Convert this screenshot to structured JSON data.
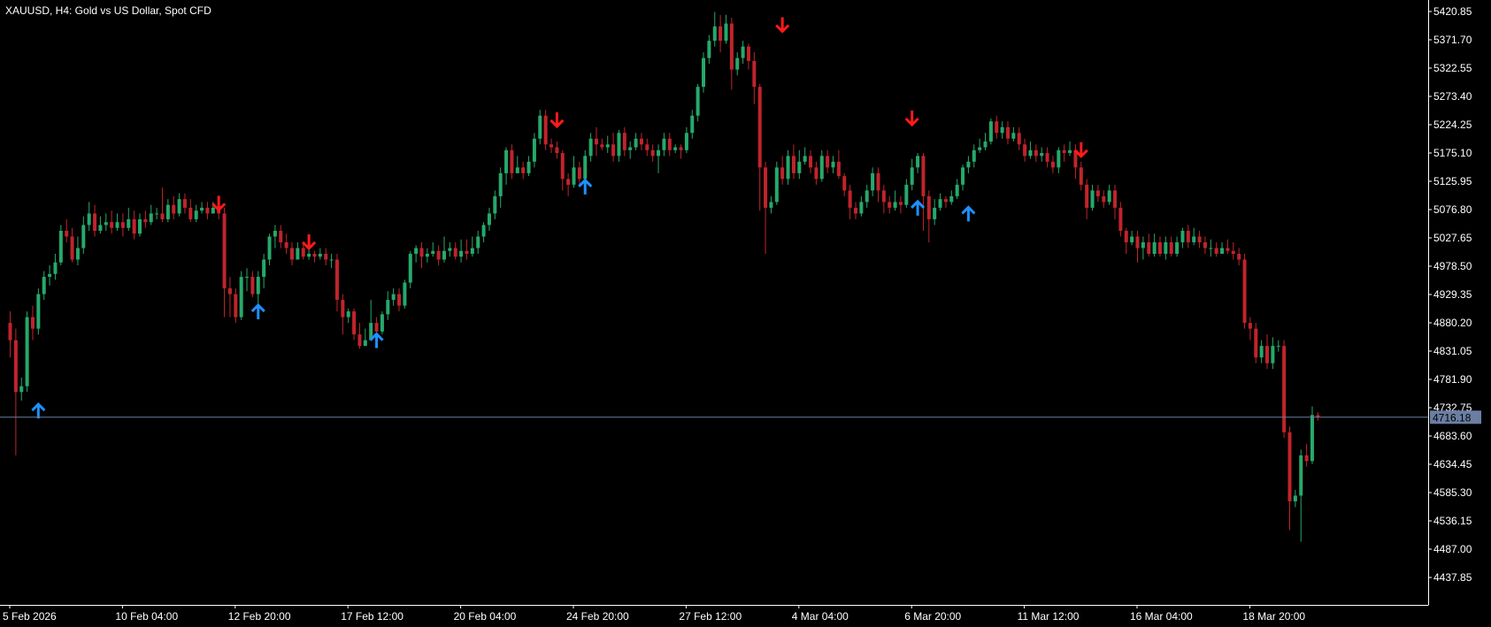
{
  "chart_data": {
    "type": "candlestick",
    "title": "XAUUSD, H4:  Gold vs US Dollar, Spot CFD",
    "ylim": [
      4400,
      5430
    ],
    "yticks": [
      "5420.85",
      "5371.70",
      "5322.55",
      "5273.40",
      "5224.25",
      "5175.10",
      "5125.95",
      "5076.80",
      "5027.65",
      "4978.50",
      "4929.35",
      "4880.20",
      "4831.05",
      "4781.90",
      "4732.75",
      "4683.60",
      "4634.45",
      "4585.30",
      "4536.15",
      "4487.00",
      "4437.85"
    ],
    "xticks": [
      {
        "label": "5 Feb 2026",
        "bar": 0
      },
      {
        "label": "10 Feb 04:00",
        "bar": 20
      },
      {
        "label": "12 Feb 20:00",
        "bar": 40
      },
      {
        "label": "17 Feb 12:00",
        "bar": 60
      },
      {
        "label": "20 Feb 04:00",
        "bar": 80
      },
      {
        "label": "24 Feb 20:00",
        "bar": 100
      },
      {
        "label": "27 Feb 12:00",
        "bar": 120
      },
      {
        "label": "4 Mar 04:00",
        "bar": 140
      },
      {
        "label": "6 Mar 20:00",
        "bar": 160
      },
      {
        "label": "11 Mar 12:00",
        "bar": 180
      },
      {
        "label": "16 Mar 04:00",
        "bar": 200
      },
      {
        "label": "18 Mar 20:00",
        "bar": 220
      }
    ],
    "current_price": "4716.18",
    "colors": {
      "up": "#26a96b",
      "down": "#c0242b",
      "up_arrow": "#1e90ff",
      "down_arrow": "#ff1a1a",
      "price_line": "#6b7fa3",
      "axis": "#ffffff",
      "background": "#000000"
    },
    "candles": [
      [
        4880,
        4850,
        4900,
        4820
      ],
      [
        4850,
        4760,
        4870,
        4650
      ],
      [
        4760,
        4770,
        4785,
        4745
      ],
      [
        4770,
        4890,
        4900,
        4760
      ],
      [
        4890,
        4870,
        4910,
        4850
      ],
      [
        4870,
        4930,
        4940,
        4860
      ],
      [
        4930,
        4960,
        4970,
        4920
      ],
      [
        4960,
        4965,
        4980,
        4945
      ],
      [
        4965,
        4985,
        5000,
        4955
      ],
      [
        4985,
        5040,
        5050,
        4980
      ],
      [
        5040,
        5030,
        5060,
        5020
      ],
      [
        5030,
        4990,
        5045,
        4985
      ],
      [
        4990,
        5010,
        5030,
        4980
      ],
      [
        5010,
        5050,
        5065,
        5000
      ],
      [
        5050,
        5070,
        5090,
        5040
      ],
      [
        5070,
        5040,
        5085,
        5030
      ],
      [
        5040,
        5050,
        5065,
        5035
      ],
      [
        5050,
        5055,
        5070,
        5040
      ],
      [
        5055,
        5045,
        5075,
        5035
      ],
      [
        5045,
        5055,
        5070,
        5040
      ],
      [
        5055,
        5045,
        5070,
        5030
      ],
      [
        5045,
        5060,
        5080,
        5040
      ],
      [
        5060,
        5035,
        5075,
        5025
      ],
      [
        5035,
        5060,
        5070,
        5030
      ],
      [
        5060,
        5055,
        5075,
        5045
      ],
      [
        5055,
        5070,
        5085,
        5050
      ],
      [
        5070,
        5070,
        5080,
        5060
      ],
      [
        5070,
        5060,
        5115,
        5055
      ],
      [
        5060,
        5085,
        5095,
        5055
      ],
      [
        5085,
        5070,
        5100,
        5060
      ],
      [
        5070,
        5095,
        5105,
        5065
      ],
      [
        5095,
        5080,
        5105,
        5070
      ],
      [
        5080,
        5060,
        5095,
        5055
      ],
      [
        5060,
        5075,
        5085,
        5055
      ],
      [
        5075,
        5080,
        5090,
        5070
      ],
      [
        5080,
        5070,
        5090,
        5060
      ],
      [
        5070,
        5080,
        5090,
        5070
      ],
      [
        5080,
        5070,
        5090,
        5060
      ],
      [
        5070,
        4940,
        5080,
        4890
      ],
      [
        4940,
        4930,
        4960,
        4890
      ],
      [
        4930,
        4890,
        4940,
        4880
      ],
      [
        4890,
        4960,
        4970,
        4885
      ],
      [
        4960,
        4960,
        4975,
        4935
      ],
      [
        4960,
        4930,
        4970,
        4925
      ],
      [
        4930,
        4960,
        4970,
        4910
      ],
      [
        4960,
        4990,
        5000,
        4940
      ],
      [
        4990,
        5030,
        5035,
        4980
      ],
      [
        5030,
        5040,
        5050,
        5010
      ],
      [
        5040,
        5020,
        5050,
        5010
      ],
      [
        5020,
        5010,
        5035,
        5000
      ],
      [
        5010,
        4990,
        5020,
        4980
      ],
      [
        4990,
        5010,
        5020,
        4990
      ],
      [
        5010,
        4995,
        5020,
        4990
      ],
      [
        4995,
        5000,
        5010,
        4990
      ],
      [
        5000,
        4995,
        5005,
        4985
      ],
      [
        4995,
        5000,
        5010,
        4990
      ],
      [
        5000,
        4990,
        5010,
        4980
      ],
      [
        4990,
        4990,
        5000,
        4975
      ],
      [
        4990,
        4920,
        5000,
        4900
      ],
      [
        4920,
        4890,
        4930,
        4860
      ],
      [
        4890,
        4900,
        4905,
        4880
      ],
      [
        4900,
        4860,
        4905,
        4850
      ],
      [
        4860,
        4840,
        4880,
        4835
      ],
      [
        4840,
        4850,
        4870,
        4840
      ],
      [
        4850,
        4880,
        4920,
        4850
      ],
      [
        4880,
        4865,
        4890,
        4860
      ],
      [
        4865,
        4895,
        4900,
        4860
      ],
      [
        4895,
        4920,
        4935,
        4885
      ],
      [
        4920,
        4930,
        4940,
        4910
      ],
      [
        4930,
        4910,
        4940,
        4900
      ],
      [
        4910,
        4950,
        4955,
        4905
      ],
      [
        4950,
        5000,
        5005,
        4940
      ],
      [
        5000,
        5010,
        5015,
        4985
      ],
      [
        5010,
        4995,
        5020,
        4975
      ],
      [
        4995,
        5000,
        5010,
        4985
      ],
      [
        5000,
        5005,
        5020,
        4995
      ],
      [
        5005,
        4990,
        5015,
        4980
      ],
      [
        4990,
        5005,
        5030,
        4985
      ],
      [
        5005,
        5010,
        5020,
        4995
      ],
      [
        5010,
        4995,
        5020,
        4990
      ],
      [
        4995,
        5005,
        5025,
        4985
      ],
      [
        5005,
        5000,
        5025,
        4990
      ],
      [
        5000,
        5010,
        5030,
        4995
      ],
      [
        5010,
        5030,
        5040,
        5000
      ],
      [
        5030,
        5050,
        5055,
        5020
      ],
      [
        5050,
        5070,
        5080,
        5040
      ],
      [
        5070,
        5100,
        5110,
        5060
      ],
      [
        5100,
        5140,
        5150,
        5080
      ],
      [
        5140,
        5180,
        5185,
        5120
      ],
      [
        5180,
        5140,
        5190,
        5130
      ],
      [
        5140,
        5150,
        5170,
        5140
      ],
      [
        5150,
        5140,
        5160,
        5130
      ],
      [
        5140,
        5160,
        5170,
        5135
      ],
      [
        5160,
        5200,
        5210,
        5150
      ],
      [
        5200,
        5240,
        5250,
        5190
      ],
      [
        5240,
        5190,
        5250,
        5180
      ],
      [
        5190,
        5185,
        5200,
        5175
      ],
      [
        5185,
        5175,
        5195,
        5165
      ],
      [
        5175,
        5130,
        5180,
        5110
      ],
      [
        5130,
        5120,
        5140,
        5100
      ],
      [
        5120,
        5150,
        5170,
        5115
      ],
      [
        5150,
        5130,
        5160,
        5120
      ],
      [
        5130,
        5170,
        5180,
        5120
      ],
      [
        5170,
        5200,
        5210,
        5160
      ],
      [
        5200,
        5190,
        5220,
        5170
      ],
      [
        5190,
        5185,
        5200,
        5180
      ],
      [
        5185,
        5190,
        5205,
        5175
      ],
      [
        5190,
        5170,
        5210,
        5160
      ],
      [
        5170,
        5210,
        5215,
        5160
      ],
      [
        5210,
        5180,
        5220,
        5170
      ],
      [
        5180,
        5185,
        5195,
        5165
      ],
      [
        5185,
        5200,
        5210,
        5180
      ],
      [
        5200,
        5190,
        5210,
        5180
      ],
      [
        5190,
        5180,
        5200,
        5170
      ],
      [
        5180,
        5170,
        5190,
        5160
      ],
      [
        5170,
        5180,
        5190,
        5140
      ],
      [
        5180,
        5200,
        5210,
        5170
      ],
      [
        5200,
        5180,
        5210,
        5170
      ],
      [
        5180,
        5185,
        5190,
        5175
      ],
      [
        5185,
        5180,
        5190,
        5165
      ],
      [
        5180,
        5210,
        5220,
        5175
      ],
      [
        5210,
        5240,
        5250,
        5200
      ],
      [
        5240,
        5290,
        5295,
        5230
      ],
      [
        5290,
        5340,
        5350,
        5280
      ],
      [
        5340,
        5370,
        5380,
        5330
      ],
      [
        5370,
        5395,
        5420,
        5360
      ],
      [
        5395,
        5370,
        5415,
        5350
      ],
      [
        5370,
        5400,
        5415,
        5365
      ],
      [
        5400,
        5320,
        5410,
        5285
      ],
      [
        5320,
        5340,
        5350,
        5310
      ],
      [
        5340,
        5360,
        5370,
        5330
      ],
      [
        5360,
        5335,
        5365,
        5320
      ],
      [
        5335,
        5290,
        5350,
        5260
      ],
      [
        5290,
        5150,
        5295,
        5075
      ],
      [
        5150,
        5080,
        5160,
        5000
      ],
      [
        5080,
        5090,
        5100,
        5070
      ],
      [
        5090,
        5150,
        5160,
        5085
      ],
      [
        5150,
        5130,
        5170,
        5120
      ],
      [
        5130,
        5170,
        5180,
        5120
      ],
      [
        5170,
        5140,
        5190,
        5130
      ],
      [
        5140,
        5160,
        5180,
        5130
      ],
      [
        5160,
        5170,
        5185,
        5155
      ],
      [
        5170,
        5150,
        5180,
        5140
      ],
      [
        5150,
        5130,
        5160,
        5120
      ],
      [
        5130,
        5170,
        5180,
        5125
      ],
      [
        5170,
        5150,
        5180,
        5140
      ],
      [
        5150,
        5160,
        5170,
        5140
      ],
      [
        5160,
        5135,
        5180,
        5130
      ],
      [
        5135,
        5110,
        5140,
        5100
      ],
      [
        5110,
        5080,
        5120,
        5060
      ],
      [
        5080,
        5070,
        5090,
        5060
      ],
      [
        5070,
        5090,
        5100,
        5065
      ],
      [
        5090,
        5110,
        5120,
        5080
      ],
      [
        5110,
        5140,
        5150,
        5100
      ],
      [
        5140,
        5110,
        5150,
        5090
      ],
      [
        5110,
        5090,
        5120,
        5070
      ],
      [
        5090,
        5080,
        5100,
        5070
      ],
      [
        5080,
        5090,
        5110,
        5075
      ],
      [
        5090,
        5085,
        5100,
        5070
      ],
      [
        5085,
        5120,
        5130,
        5080
      ],
      [
        5120,
        5150,
        5165,
        5110
      ],
      [
        5150,
        5170,
        5175,
        5140
      ],
      [
        5170,
        5100,
        5175,
        5040
      ],
      [
        5100,
        5060,
        5110,
        5020
      ],
      [
        5060,
        5080,
        5095,
        5050
      ],
      [
        5080,
        5095,
        5105,
        5075
      ],
      [
        5095,
        5090,
        5100,
        5080
      ],
      [
        5090,
        5100,
        5110,
        5085
      ],
      [
        5100,
        5120,
        5130,
        5095
      ],
      [
        5120,
        5150,
        5155,
        5110
      ],
      [
        5150,
        5160,
        5170,
        5140
      ],
      [
        5160,
        5180,
        5190,
        5150
      ],
      [
        5180,
        5185,
        5200,
        5175
      ],
      [
        5185,
        5195,
        5210,
        5180
      ],
      [
        5195,
        5230,
        5235,
        5190
      ],
      [
        5230,
        5210,
        5240,
        5200
      ],
      [
        5210,
        5220,
        5230,
        5200
      ],
      [
        5220,
        5200,
        5230,
        5190
      ],
      [
        5200,
        5210,
        5220,
        5195
      ],
      [
        5210,
        5190,
        5220,
        5180
      ],
      [
        5190,
        5170,
        5200,
        5160
      ],
      [
        5170,
        5180,
        5195,
        5165
      ],
      [
        5180,
        5170,
        5190,
        5160
      ],
      [
        5170,
        5175,
        5185,
        5160
      ],
      [
        5175,
        5160,
        5185,
        5150
      ],
      [
        5160,
        5150,
        5170,
        5140
      ],
      [
        5150,
        5180,
        5185,
        5140
      ],
      [
        5180,
        5175,
        5190,
        5160
      ],
      [
        5175,
        5180,
        5195,
        5170
      ],
      [
        5180,
        5150,
        5190,
        5130
      ],
      [
        5150,
        5120,
        5160,
        5110
      ],
      [
        5120,
        5080,
        5130,
        5060
      ],
      [
        5080,
        5110,
        5120,
        5075
      ],
      [
        5110,
        5100,
        5120,
        5090
      ],
      [
        5100,
        5090,
        5110,
        5080
      ],
      [
        5090,
        5110,
        5120,
        5085
      ],
      [
        5110,
        5080,
        5120,
        5060
      ],
      [
        5080,
        5040,
        5090,
        5030
      ],
      [
        5040,
        5020,
        5045,
        5000
      ],
      [
        5020,
        5030,
        5040,
        5015
      ],
      [
        5030,
        5010,
        5040,
        4985
      ],
      [
        5010,
        5020,
        5030,
        4990
      ],
      [
        5020,
        5000,
        5035,
        4995
      ],
      [
        5000,
        5020,
        5035,
        4995
      ],
      [
        5020,
        5000,
        5030,
        4995
      ],
      [
        5000,
        5020,
        5030,
        4990
      ],
      [
        5020,
        5000,
        5030,
        4995
      ],
      [
        5000,
        5020,
        5030,
        4995
      ],
      [
        5020,
        5040,
        5045,
        5010
      ],
      [
        5040,
        5020,
        5050,
        5010
      ],
      [
        5020,
        5030,
        5045,
        5015
      ],
      [
        5030,
        5020,
        5040,
        5010
      ],
      [
        5020,
        5010,
        5030,
        5000
      ],
      [
        5010,
        5010,
        5025,
        4995
      ],
      [
        5010,
        5000,
        5020,
        4995
      ],
      [
        5000,
        5010,
        5020,
        5000
      ],
      [
        5010,
        5005,
        5025,
        5000
      ],
      [
        5005,
        5000,
        5020,
        4990
      ],
      [
        5000,
        4990,
        5010,
        4980
      ],
      [
        4990,
        4880,
        5000,
        4870
      ],
      [
        4880,
        4870,
        4890,
        4850
      ],
      [
        4870,
        4820,
        4880,
        4810
      ],
      [
        4820,
        4840,
        4850,
        4810
      ],
      [
        4840,
        4810,
        4860,
        4800
      ],
      [
        4810,
        4840,
        4855,
        4800
      ],
      [
        4840,
        4840,
        4850,
        4830
      ],
      [
        4840,
        4690,
        4850,
        4680
      ],
      [
        4690,
        4570,
        4700,
        4520
      ],
      [
        4570,
        4580,
        4590,
        4560
      ],
      [
        4580,
        4650,
        4660,
        4500
      ],
      [
        4650,
        4640,
        4670,
        4630
      ],
      [
        4640,
        4720,
        4735,
        4635
      ],
      [
        4720,
        4716,
        4725,
        4710
      ]
    ],
    "arrows": [
      {
        "bar": 5,
        "dir": "up",
        "price": 4728
      },
      {
        "bar": 37,
        "dir": "down",
        "price": 5087
      },
      {
        "bar": 44,
        "dir": "up",
        "price": 4900
      },
      {
        "bar": 53,
        "dir": "down",
        "price": 5020
      },
      {
        "bar": 65,
        "dir": "up",
        "price": 4850
      },
      {
        "bar": 97,
        "dir": "down",
        "price": 5232
      },
      {
        "bar": 102,
        "dir": "up",
        "price": 5117
      },
      {
        "bar": 137,
        "dir": "down",
        "price": 5397
      },
      {
        "bar": 160,
        "dir": "down",
        "price": 5235
      },
      {
        "bar": 161,
        "dir": "up",
        "price": 5080
      },
      {
        "bar": 170,
        "dir": "up",
        "price": 5070
      },
      {
        "bar": 190,
        "dir": "down",
        "price": 5180
      }
    ]
  }
}
